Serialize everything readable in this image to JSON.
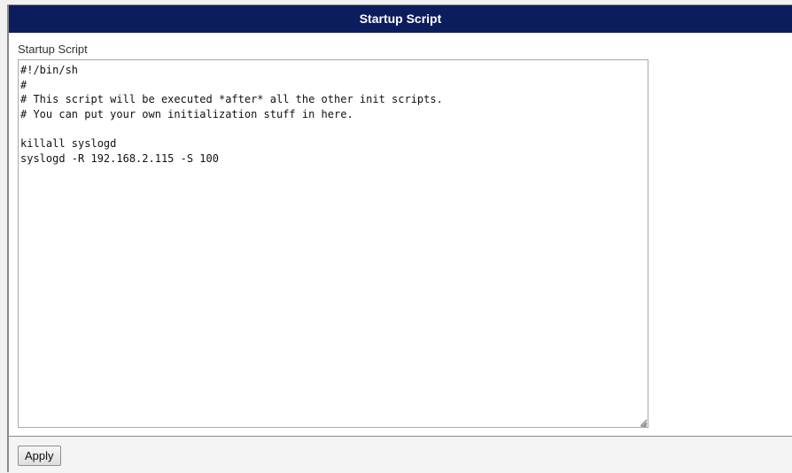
{
  "header": {
    "title": "Startup Script"
  },
  "form": {
    "label": "Startup Script",
    "script_text": "#!/bin/sh\n#\n# This script will be executed *after* all the other init scripts.\n# You can put your own initialization stuff in here.\n\nkillall syslogd\nsyslogd -R 192.168.2.115 -S 100"
  },
  "footer": {
    "apply_label": "Apply"
  },
  "colors": {
    "header_bg": "#0c1d5e",
    "header_text": "#ffffff",
    "footer_bg": "#f4f4f4"
  }
}
